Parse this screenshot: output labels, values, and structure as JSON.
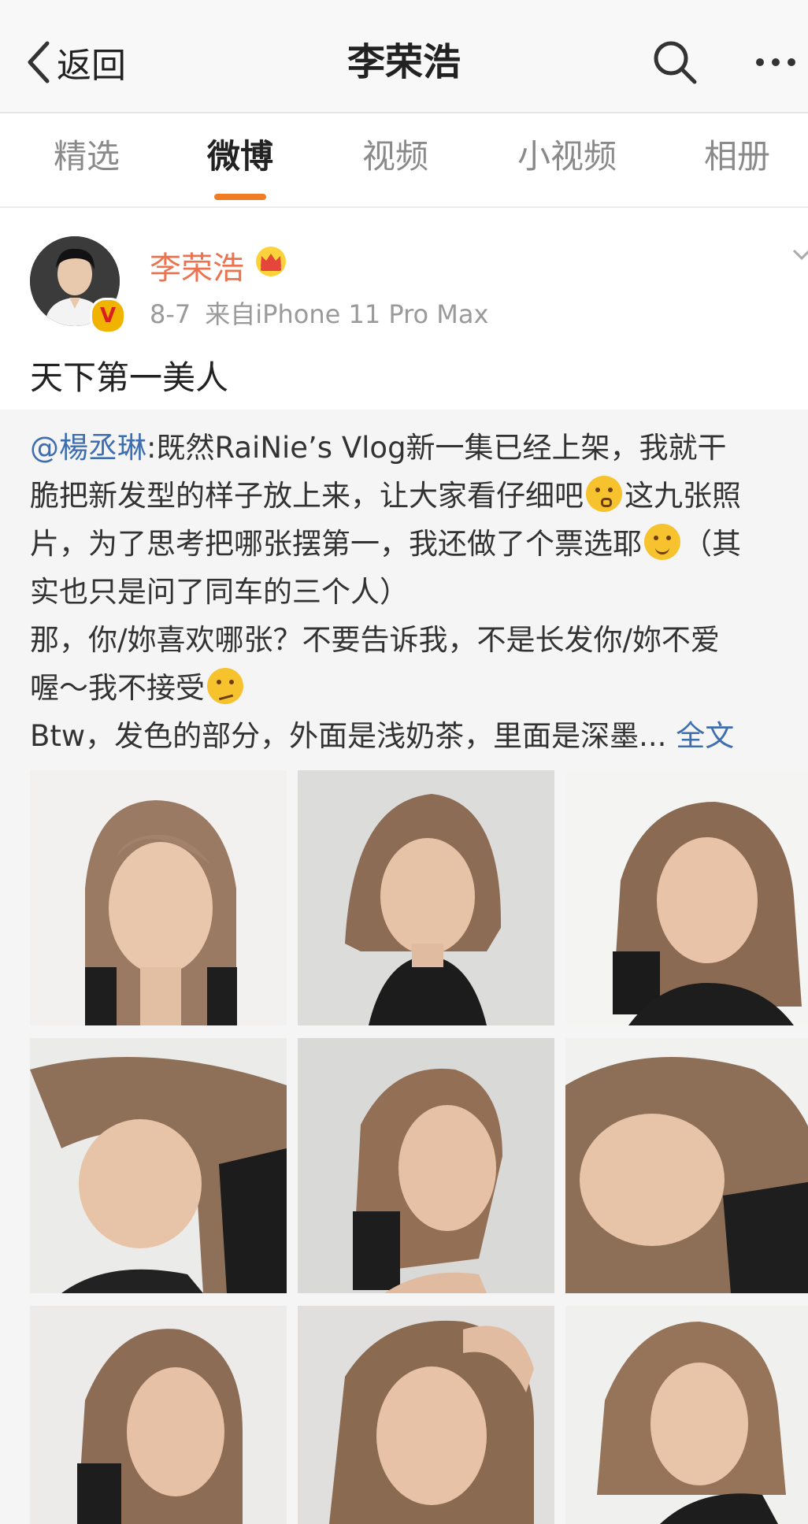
{
  "header": {
    "back_label": "返回",
    "title": "李荣浩",
    "icons": [
      "chevron-left-icon",
      "search-icon",
      "more-icon"
    ]
  },
  "tabs": [
    {
      "label": "精选",
      "active": false
    },
    {
      "label": "微博",
      "active": true
    },
    {
      "label": "视频",
      "active": false
    },
    {
      "label": "小视频",
      "active": false
    },
    {
      "label": "相册",
      "active": false
    }
  ],
  "accent_color": "#f07c26",
  "post": {
    "author": "李荣浩",
    "verified_mark": "V",
    "date": "8-7",
    "source": "来自iPhone 11 Pro Max",
    "text": "天下第一美人"
  },
  "repost": {
    "mention": "@楊丞琳",
    "line1": ":既然RaiNie’s Vlog新一集已经上架，我就干",
    "line2a": "脆把新发型的样子放上来，让大家看仔细吧",
    "line2b": "这九张照",
    "line3a": "片，为了思考把哪张摆第一，我还做了个票选耶",
    "line3b": "（其",
    "line4": "实也只是问了同车的三个人）",
    "line5": "那，你/妳喜欢哪张？不要告诉我，不是长发你/妳不爱",
    "line6": "喔～我不接受",
    "line7": "Btw，发色的部分，外面是浅奶茶，里面是深墨...",
    "more_link": "全文",
    "emojis": [
      "kissing-emoji",
      "sweat-smile-emoji",
      "woozy-emoji"
    ],
    "photo_count": 9
  }
}
